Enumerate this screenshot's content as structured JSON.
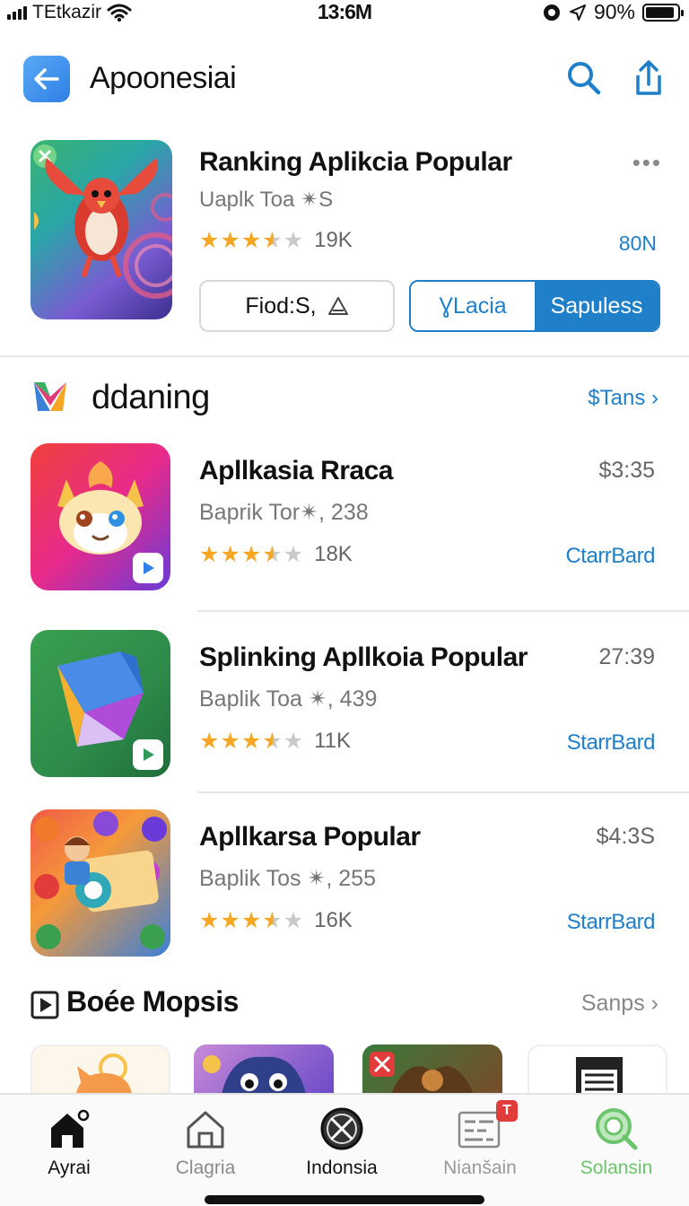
{
  "status_bar": {
    "carrier": "TEtkazir",
    "time": "13:6M",
    "battery_text": "90%",
    "battery_level": 0.9
  },
  "header": {
    "title": "Apoonesiai"
  },
  "featured": {
    "name": "Ranking Aplikcia Popular",
    "developer": "Uaplk Toa ✴S",
    "rating": 3.5,
    "rating_count": "19K",
    "price": "80N",
    "more": "•••",
    "outline_button": "Fiod:S,",
    "segment_a": "ƔLacia",
    "segment_b": "Sapuless"
  },
  "section1": {
    "title": "ddaning",
    "see_all": "$Tans ›"
  },
  "apps": [
    {
      "name": "Apllkasia Rraca",
      "developer": "Baprik Tor✴, 238",
      "rating": 3.5,
      "rating_count": "18K",
      "time": "$3:35",
      "action": "CtarrBard"
    },
    {
      "name": "Splinking Apllkoia Popular",
      "developer": "Baplik Toa ✴, 439",
      "rating": 3.5,
      "rating_count": "11K",
      "time": "27:39",
      "action": "StarrBard"
    },
    {
      "name": "Apllkarsa Popular",
      "developer": "Baplik Tos ✴, 255",
      "rating": 3.5,
      "rating_count": "16K",
      "time": "$4:3S",
      "action": "StarrBard"
    }
  ],
  "section2": {
    "title": "Boée Mopsis",
    "see_all": "Sanps ›"
  },
  "tabs": [
    {
      "label": "Ayrai",
      "icon": "home-icon",
      "color": "#111111"
    },
    {
      "label": "Clagria",
      "icon": "house-outline-icon",
      "color": "#8a8a8a"
    },
    {
      "label": "Indonsia",
      "icon": "compass-icon",
      "color": "#111111"
    },
    {
      "label": "Nianšain",
      "icon": "grid-icon",
      "color": "#9a9a9a",
      "badge": "T"
    },
    {
      "label": "Solansin",
      "icon": "search-icon",
      "color": "#6cc46c"
    }
  ],
  "colors": {
    "accent": "#1f7fc8",
    "star": "#f5a623",
    "badge": "#e23b3b"
  }
}
